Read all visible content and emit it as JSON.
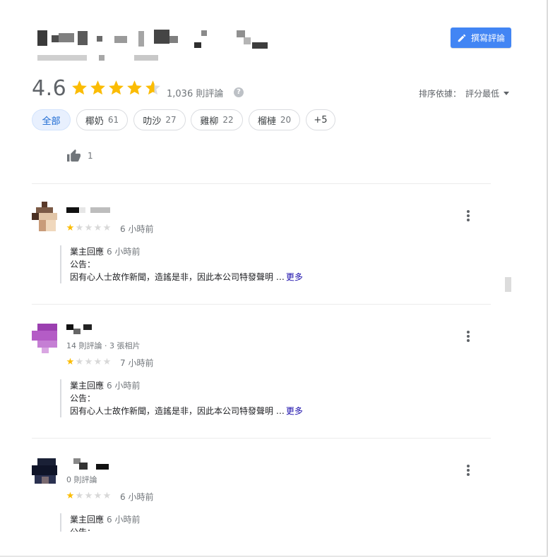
{
  "header": {
    "write_review_label": "撰寫評論",
    "write_review_icon": "pencil-icon"
  },
  "summary": {
    "rating": "4.6",
    "star_fraction": 0.92,
    "review_count": "1,036 則評論",
    "help_glyph": "?",
    "sort_label": "排序依據：",
    "sort_value": "評分最低"
  },
  "chips": [
    {
      "label": "全部",
      "count": ""
    },
    {
      "label": "椰奶",
      "count": "61"
    },
    {
      "label": "叻沙",
      "count": "27"
    },
    {
      "label": "雞柳",
      "count": "22"
    },
    {
      "label": "榴槤",
      "count": "20"
    },
    {
      "label": "+5",
      "count": ""
    }
  ],
  "prev_review": {
    "likes": "1"
  },
  "reviews": [
    {
      "stars": 1,
      "time": "6 小時前",
      "meta": "",
      "reply_owner": "業主回應",
      "reply_time": "6 小時前",
      "reply_line1": "公告：",
      "reply_line2": "因有心人士故作新聞，造謠是非，因此本公司特發聲明 …",
      "more": "更多"
    },
    {
      "stars": 1,
      "time": "7 小時前",
      "meta": "14 則評論 · 3 張相片",
      "reply_owner": "業主回應",
      "reply_time": "6 小時前",
      "reply_line1": "公告：",
      "reply_line2": "因有心人士故作新聞，造謠是非，因此本公司特發聲明 …",
      "more": "更多"
    },
    {
      "stars": 1,
      "time": "6 小時前",
      "meta": "0 則評論",
      "reply_owner": "業主回應",
      "reply_time": "6 小時前",
      "reply_line1": "公告："
    }
  ],
  "colors": {
    "accent": "#4285f4",
    "star": "#fbbc04",
    "link": "#1a0dab"
  }
}
